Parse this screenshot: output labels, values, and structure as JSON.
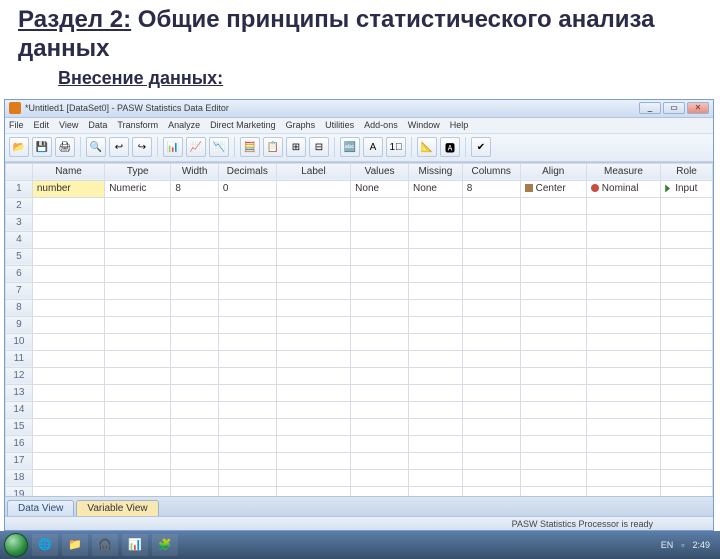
{
  "slide": {
    "section_prefix": "Раздел 2:",
    "section_rest": " Общие принципы статистического анализа данных",
    "sub": "Внесение данных:"
  },
  "window": {
    "title": "*Untitled1 [DataSet0] - PASW Statistics Data Editor",
    "min": "_",
    "max": "▭",
    "close": "✕"
  },
  "menu": [
    "File",
    "Edit",
    "View",
    "Data",
    "Transform",
    "Analyze",
    "Direct Marketing",
    "Graphs",
    "Utilities",
    "Add-ons",
    "Window",
    "Help"
  ],
  "toolbar_icons": [
    "📂",
    "💾",
    "🖨",
    "",
    "🔍",
    "↩",
    "↪",
    "",
    "📊",
    "📈",
    "📉",
    "",
    "🧮",
    "📋",
    "⊞",
    "⊟",
    "",
    "🔤",
    "A",
    "1⃣",
    "",
    "📐",
    "🅰",
    "",
    "✔"
  ],
  "columns": [
    "Name",
    "Type",
    "Width",
    "Decimals",
    "Label",
    "Values",
    "Missing",
    "Columns",
    "Align",
    "Measure",
    "Role"
  ],
  "row1": {
    "name": "number",
    "type": "Numeric",
    "width": "8",
    "decimals": "0",
    "label": "",
    "values": "None",
    "missing": "None",
    "columns": "8",
    "align": "Center",
    "measure": "Nominal",
    "role": "Input"
  },
  "row_numbers": [
    "1",
    "2",
    "3",
    "4",
    "5",
    "6",
    "7",
    "8",
    "9",
    "10",
    "11",
    "12",
    "13",
    "14",
    "15",
    "16",
    "17",
    "18",
    "19"
  ],
  "tabs": {
    "data": "Data View",
    "variable": "Variable View"
  },
  "status": "PASW Statistics Processor is ready",
  "taskbar": {
    "lang": "EN",
    "time": "2:49"
  }
}
